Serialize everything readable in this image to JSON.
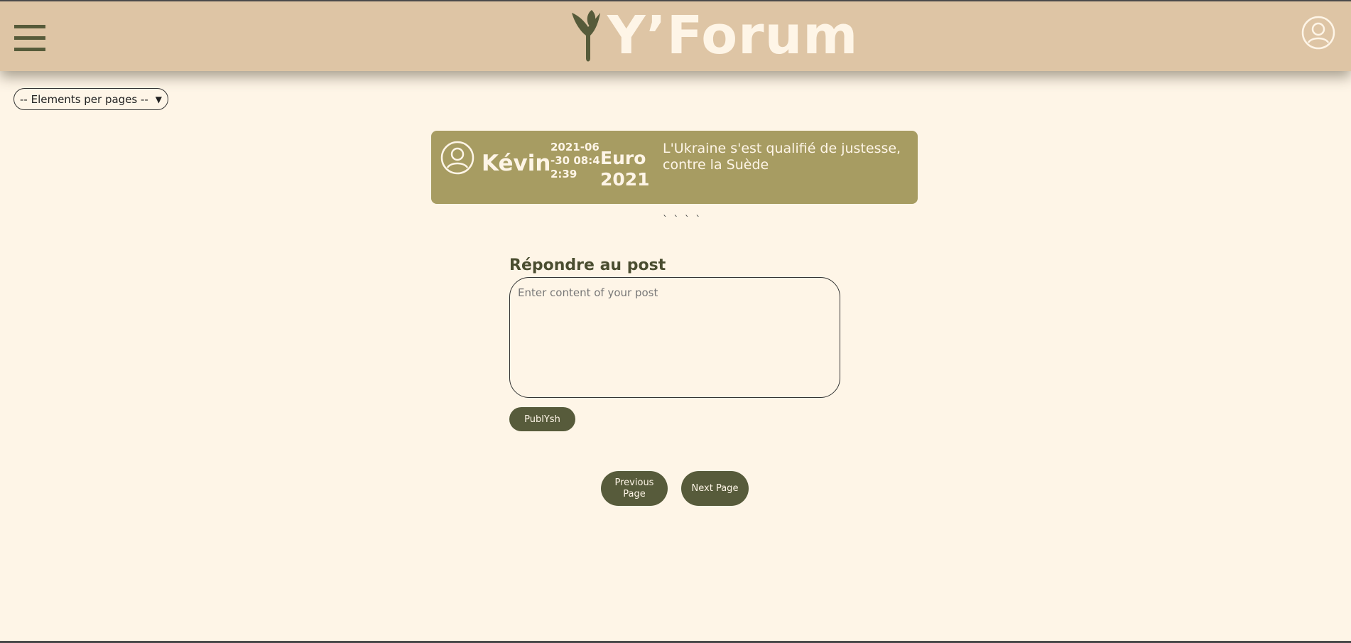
{
  "header": {
    "logo_text": "Y’Forum",
    "menu_icon": "hamburger-menu-icon",
    "profile_icon": "user-circle-icon"
  },
  "toolbar": {
    "per_page_label": "-- Elements per pages --"
  },
  "post": {
    "author": "Kévin",
    "date": "2021-06-30 08:42:39",
    "title": "Euro 2021",
    "content": "L'Ukraine s'est qualifié de justesse, contre la Suède",
    "ticks": "` ` ` `"
  },
  "reply": {
    "title": "Répondre au post",
    "placeholder": "Enter content of your post",
    "publish_label": "PublYsh"
  },
  "pagination": {
    "prev_label": "Previous Page",
    "next_label": "Next Page"
  },
  "colors": {
    "background": "#fef5e7",
    "header": "#dec5a5",
    "card": "#a79c62",
    "button": "#575b3b"
  }
}
